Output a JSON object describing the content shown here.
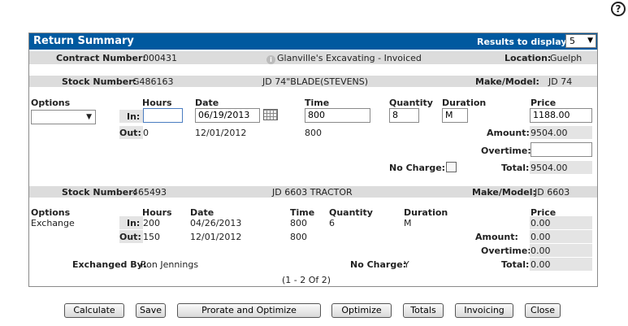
{
  "help": {
    "glyph": "?"
  },
  "header": {
    "title": "Return Summary",
    "results_label": "Results to display:",
    "results_value": "5"
  },
  "contract": {
    "number_label": "Contract Number:",
    "number_value": "000431",
    "customer": "Glanville's Excavating - Invoiced",
    "location_label": "Location:",
    "location_value": "Guelph"
  },
  "item1": {
    "stock_label": "Stock Number:",
    "stock_value": "G486163",
    "description": "JD 74\"BLADE(STEVENS)",
    "make_label": "Make/Model:",
    "make_value": "JD 74",
    "col_options": "Options",
    "col_hours": "Hours",
    "col_date": "Date",
    "col_time": "Time",
    "col_quantity": "Quantity",
    "col_duration": "Duration",
    "col_price": "Price",
    "in_label": "In:",
    "in_hours": "",
    "in_date": "06/19/2013",
    "in_time": "800",
    "in_quantity": "8",
    "in_duration": "M",
    "price": "1188.00",
    "out_label": "Out:",
    "out_hours": "0",
    "out_date": "12/01/2012",
    "out_time": "800",
    "amount_label": "Amount:",
    "amount_value": "9504.00",
    "overtime_label": "Overtime:",
    "overtime_value": "",
    "nocharge_label": "No Charge:",
    "total_label": "Total:",
    "total_value": "9504.00"
  },
  "item2": {
    "stock_label": "Stock Number:",
    "stock_value": "465493",
    "description": "JD 6603 TRACTOR",
    "make_label": "Make/Model:",
    "make_value": "JD 6603",
    "col_options": "Options",
    "col_hours": "Hours",
    "col_date": "Date",
    "col_time": "Time",
    "col_quantity": "Quantity",
    "col_duration": "Duration",
    "col_price": "Price",
    "option_value": "Exchange",
    "in_label": "In:",
    "in_hours": "200",
    "in_date": "04/26/2013",
    "in_time": "800",
    "in_quantity": "6",
    "in_duration": "M",
    "price": "0.00",
    "out_label": "Out:",
    "out_hours": "150",
    "out_date": "12/01/2012",
    "out_time": "800",
    "amount_label": "Amount:",
    "amount_value": "0.00",
    "overtime_label": "Overtime:",
    "overtime_value": "0.00",
    "exchanged_label": "Exchanged By:",
    "exchanged_value": "Ron Jennings",
    "nocharge_label": "No Charge:",
    "nocharge_value": "Y",
    "total_label": "Total:",
    "total_value": "0.00"
  },
  "pagination": "(1 - 2 Of 2)",
  "buttons": {
    "calculate": "Calculate",
    "save": "Save",
    "prorate": "Prorate and Optimize",
    "optimize": "Optimize",
    "totals": "Totals",
    "invoicing": "Invoicing",
    "close": "Close"
  }
}
